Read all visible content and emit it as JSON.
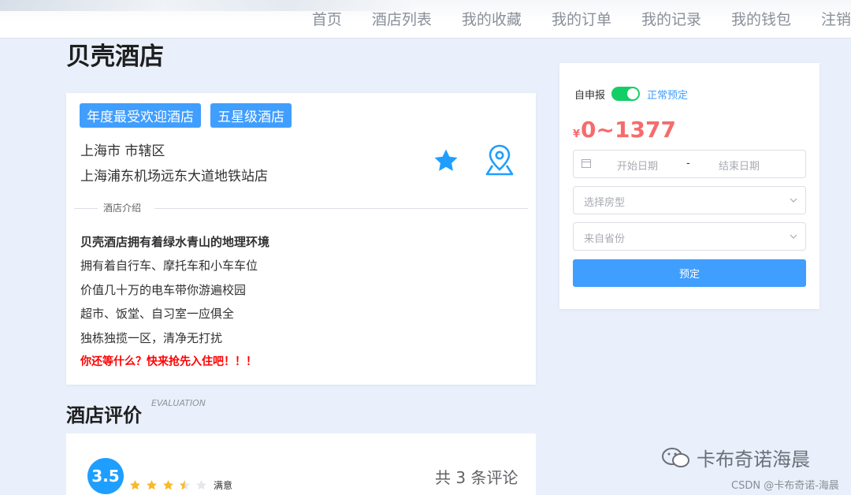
{
  "nav": {
    "items": [
      "首页",
      "酒店列表",
      "我的收藏",
      "我的订单",
      "我的记录",
      "我的钱包",
      "注销"
    ]
  },
  "hotel": {
    "name": "贝壳酒店",
    "tags": [
      "年度最受欢迎酒店",
      "五星级酒店"
    ],
    "address_line1": "上海市 市辖区",
    "address_line2": "上海浦东机场远东大道地铁站店",
    "intro_divider": "酒店介绍",
    "intro": [
      "贝壳酒店拥有着绿水青山的地理环境",
      "拥有着自行车、摩托车和小车车位",
      "价值几十万的电车带你游遍校园",
      "超市、饭堂、自习室一应俱全",
      "独栋独揽一区，清净无打扰",
      "你还等什么？快来抢先入住吧！！！"
    ]
  },
  "evaluation": {
    "title": "酒店评价",
    "subtitle": "EVALUATION",
    "score": "3.5",
    "rating_value": 3.5,
    "rating_max": 5,
    "rating_text": "满意",
    "count_text": "共 3 条评论"
  },
  "booking": {
    "self_report_label": "自申报",
    "switch_on": true,
    "normal_label": "正常预定",
    "currency": "¥",
    "price": "0~1377",
    "start_placeholder": "开始日期",
    "date_sep": "-",
    "end_placeholder": "结束日期",
    "room_placeholder": "选择房型",
    "province_placeholder": "来自省份",
    "submit_label": "预定"
  },
  "watermark": {
    "brand": "卡布奇诺海晨",
    "csdn": "CSDN @卡布奇诺-海晨"
  },
  "colors": {
    "primary": "#409eff",
    "switch": "#13ce66",
    "price": "#f56c6c",
    "alert": "#ff0000",
    "star": "#f7ba2a"
  }
}
